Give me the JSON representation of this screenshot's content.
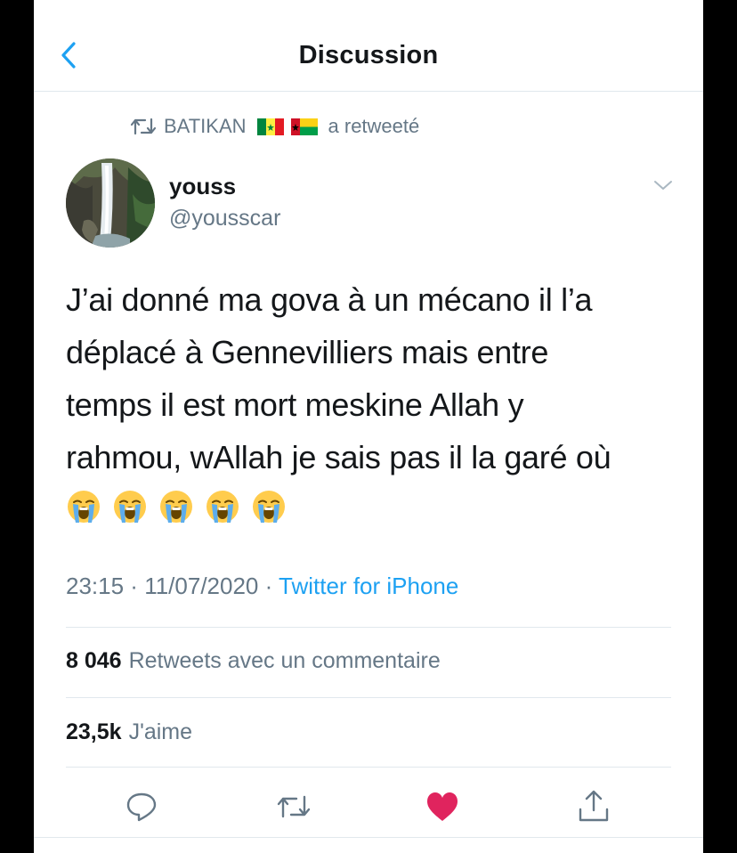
{
  "header": {
    "title": "Discussion",
    "back_icon": "chevron-left-icon"
  },
  "retweet": {
    "icon": "retweet-icon",
    "user": "BATIKAN",
    "flags": [
      "senegal-flag",
      "guinea-bissau-flag"
    ],
    "suffix": "a retweeté"
  },
  "tweet": {
    "author_name": "youss",
    "author_handle": "@yousscar",
    "lines": [
      "J’ai donné ma gova à un mécano il l’a",
      "déplacé à Gennevilliers mais entre",
      "temps il est mort meskine Allah y",
      "rahmou, wAllah je sais pas il la garé où"
    ],
    "emojis": [
      "loudly-crying-face",
      "loudly-crying-face",
      "loudly-crying-face",
      "loudly-crying-face",
      "loudly-crying-face"
    ],
    "time": "23:15",
    "date": "11/07/2020",
    "separator": " · ",
    "source": "Twitter for iPhone"
  },
  "stats": {
    "retweets_count": "8 046",
    "retweets_label": "Retweets avec un commentaire",
    "likes_count": "23,5k",
    "likes_label": "J'aime"
  },
  "actions": {
    "reply_icon": "reply-icon",
    "retweet_icon": "retweet-icon",
    "like_icon": "heart-icon",
    "share_icon": "share-icon",
    "like_color": "#e0245e"
  },
  "colors": {
    "accent": "#1da1f2",
    "text": "#14171a",
    "secondary": "#657786",
    "border": "#e1e8ed"
  }
}
